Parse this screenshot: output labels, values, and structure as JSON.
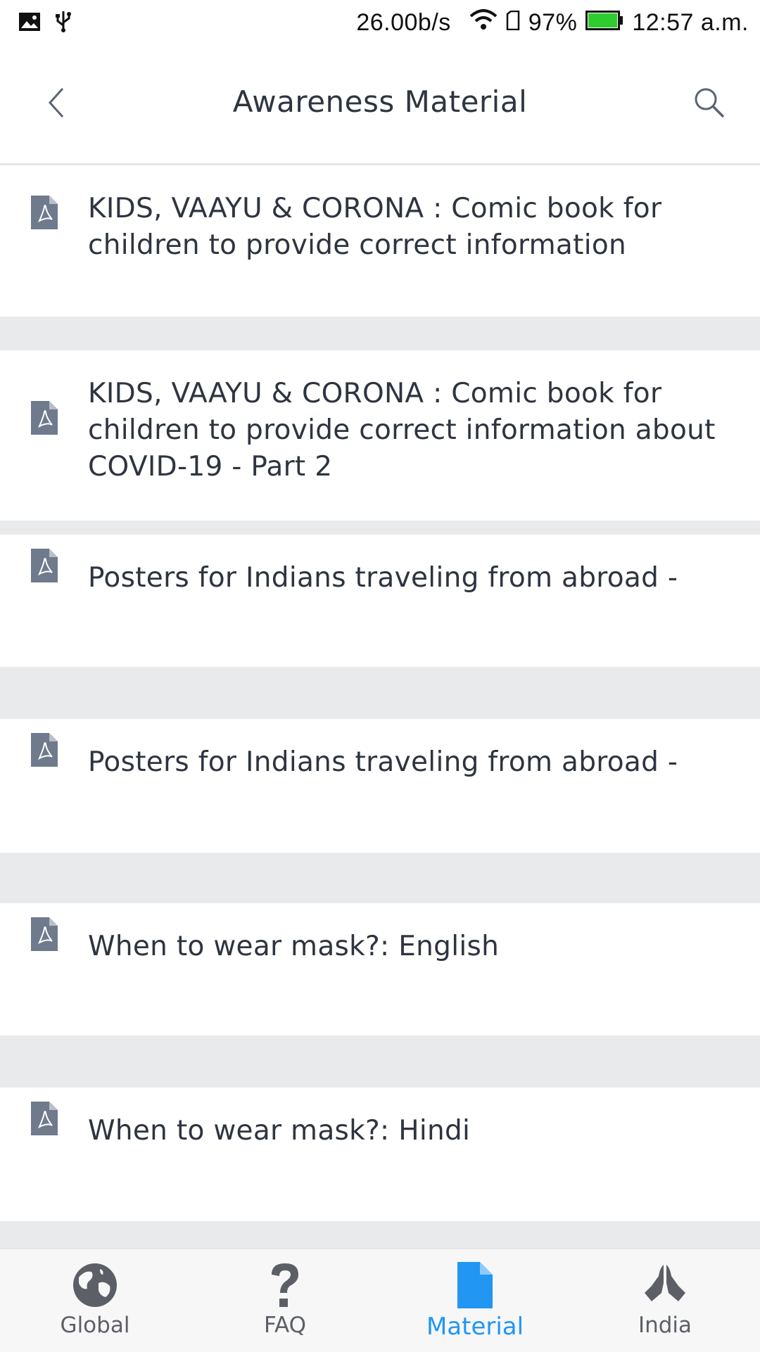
{
  "status_bar": {
    "net_speed": "26.00b/s",
    "battery": "97%",
    "time": "12:57 a.m.",
    "icons": [
      "image-icon",
      "usb-icon",
      "wifi-icon",
      "sim-icon",
      "battery-icon"
    ],
    "battery_color": "#2ecc2e"
  },
  "header": {
    "title": "Awareness Material",
    "back_icon": "chevron-left-icon",
    "search_icon": "search-icon"
  },
  "materials": [
    {
      "title": "KIDS, VAAYU & CORONA : Comic book for children to provide correct information",
      "icon": "pdf-file-icon"
    },
    {
      "title": "KIDS, VAAYU & CORONA : Comic book for children to provide correct information about COVID-19 - Part 2",
      "icon": "pdf-file-icon"
    },
    {
      "title": "Posters for Indians traveling from abroad -",
      "icon": "pdf-file-icon"
    },
    {
      "title": "Posters for Indians traveling from abroad -",
      "icon": "pdf-file-icon"
    },
    {
      "title": "When to wear mask?: English",
      "icon": "pdf-file-icon"
    },
    {
      "title": "When to wear mask?: Hindi",
      "icon": "pdf-file-icon"
    }
  ],
  "bottom_nav": {
    "items": [
      {
        "label": "Global",
        "icon": "globe-icon"
      },
      {
        "label": "FAQ",
        "icon": "question-mark-icon"
      },
      {
        "label": "Material",
        "icon": "document-icon",
        "active": true
      },
      {
        "label": "India",
        "icon": "praying-hands-icon"
      }
    ],
    "active_color": "#2196f3",
    "inactive_color": "#5c5f66"
  }
}
